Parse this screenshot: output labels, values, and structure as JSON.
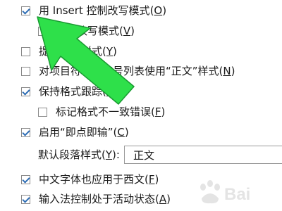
{
  "options": [
    {
      "label": "用 Insert 控制改写模式",
      "key": "O",
      "checked": true
    },
    {
      "label": "使用改写模式",
      "key": "V",
      "checked": false
    },
    {
      "label": "提示更新样式",
      "key": "Y",
      "checked": false
    },
    {
      "label": "对项目符号或编号列表使用“正文”样式",
      "key": "N",
      "checked": false
    },
    {
      "label": "保持格式跟踪",
      "key": "E",
      "checked": true
    },
    {
      "label": "标记格式不一致错误",
      "key": "F",
      "checked": false
    },
    {
      "label": "启用“即点即输”",
      "key": "C",
      "checked": true
    }
  ],
  "default_style": {
    "label": "默认段落样式",
    "key": "Y",
    "value": "正文"
  },
  "options_bottom": [
    {
      "label": "中文字体也应用于西文",
      "key": "F",
      "checked": true
    },
    {
      "label": "输入法控制处于活动状态",
      "key": "A",
      "checked": true
    }
  ],
  "annotation_arrow": {
    "color": "#2ee04a",
    "outline": "#1a9a32"
  },
  "watermark": {
    "text": "Bai"
  }
}
